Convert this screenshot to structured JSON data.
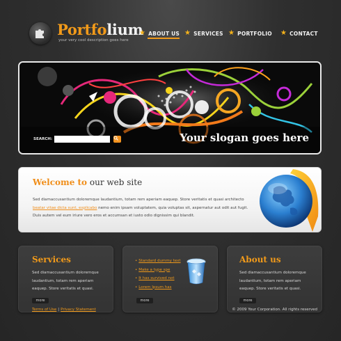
{
  "header": {
    "brand_part1": "Portfo",
    "brand_part2": "lium",
    "tagline": "your very cool description goes here"
  },
  "nav": {
    "items": [
      {
        "label": "ABOUT US",
        "active": true
      },
      {
        "label": "SERVICES",
        "active": false
      },
      {
        "label": "PORTFOLIO",
        "active": false
      },
      {
        "label": "CONTACT",
        "active": false
      }
    ]
  },
  "banner": {
    "search_label": "SEARCH:",
    "search_value": "",
    "slogan": "Your slogan goes here"
  },
  "welcome": {
    "title_accent": "Welcome to",
    "title_rest": " our web site",
    "text_before_link": "Sed diamaccusantium doloremque laudantium, totam rem aperiam eaquep. Store veritatis et quasi architecto ",
    "link_text": "beatar vitae dicta sunt, explicabo",
    "text_after_link": " nemo enim ipsam voluptatem, quia voluptas sit, aspernatur aut odit aut fugit. Duis autem vel eum iriure vero eros et accumsan et iusto odio dignissim qui blandit."
  },
  "cards": {
    "services": {
      "title": "Services",
      "text": "Sed diamaccusantium doloremque laudantium, totam rem aperiam eaquep. Store veritatis et quasi.",
      "more_label": "more"
    },
    "links": {
      "items": [
        "Standard dummy text",
        "Make a type spe",
        "It has survived not",
        "Lorem Ipsum has"
      ],
      "more_label": "more"
    },
    "about": {
      "title": "About us",
      "text": "Sed diamaccusantium doloremque laudantium, totam rem aperiam eaquep. Store veritatis et quasi.",
      "more_label": "more"
    }
  },
  "footer": {
    "terms_label": "Terms of Use",
    "separator": "|",
    "privacy_label": "Privacy Statement",
    "copyright": "© 2009 Your Corporation. All rights reserved"
  },
  "colors": {
    "accent": "#f19a1a",
    "background": "#2f2f2f",
    "star": "#f5b21b"
  }
}
